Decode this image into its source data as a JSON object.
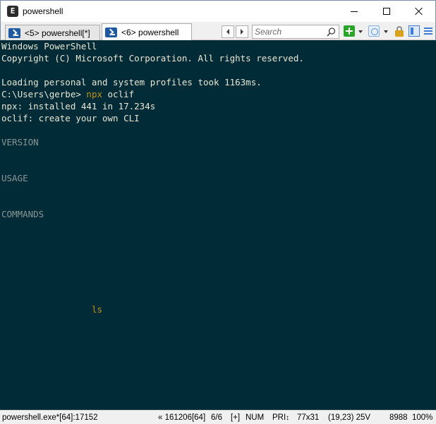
{
  "window": {
    "title": "powershell",
    "app_icon_glyph": "E"
  },
  "tabs": [
    {
      "label": "<5> powershell[*]",
      "active": false
    },
    {
      "label": "<6> powershell",
      "active": true
    }
  ],
  "toolbar": {
    "search_placeholder": "Search"
  },
  "console": {
    "lines": [
      {
        "text": "Windows PowerShell",
        "style": "normal"
      },
      {
        "text": "Copyright (C) Microsoft Corporation. All rights reserved.",
        "style": "normal"
      },
      {
        "text": "",
        "style": "normal"
      },
      {
        "text": "Loading personal and system profiles took 1163ms.",
        "style": "normal"
      },
      {
        "prompt": "C:\\Users\\gerbe> ",
        "command": "npx",
        "args": " oclif"
      },
      {
        "text": "npx: installed 441 in 17.234s",
        "style": "normal"
      },
      {
        "text": "oclif: create your own CLI",
        "style": "normal"
      },
      {
        "text": "VERSION",
        "style": "header"
      },
      {
        "text": "USAGE",
        "style": "header"
      },
      {
        "text": "COMMANDS",
        "style": "header"
      },
      {
        "text": "ls",
        "style": "input"
      }
    ]
  },
  "statusbar": {
    "process": "powershell.exe*[64]:17152",
    "build": "« 161206[64]",
    "tab_count": "6/6",
    "insert_mode": "[+]",
    "num_lock": "NUM",
    "priority": "PRI",
    "size": "77x31",
    "cursor": "(19,23) 25V",
    "pid": "8988",
    "zoom": "100%"
  },
  "colors": {
    "console_bg": "#012b36",
    "console_fg": "#e9e6d4",
    "header_fg": "#8a9696",
    "accent_fg": "#c29416"
  }
}
